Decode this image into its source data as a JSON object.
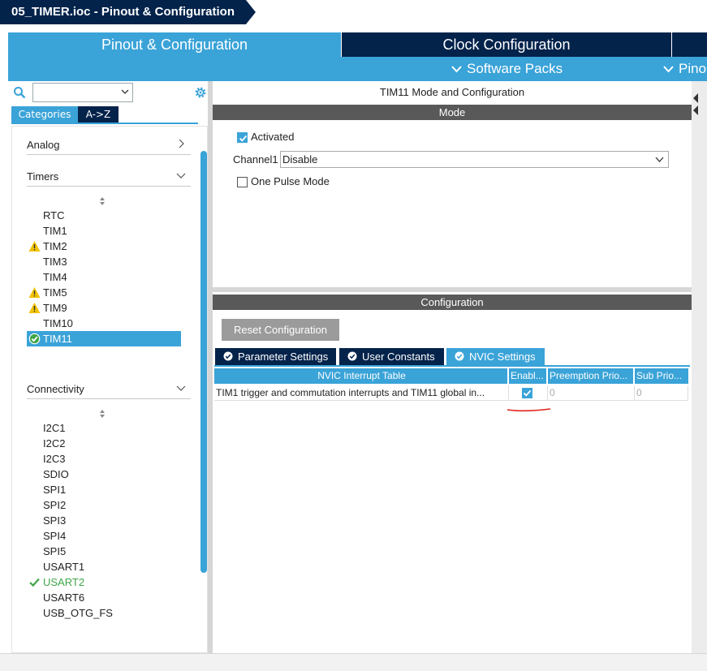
{
  "window": {
    "title": "05_TIMER.ioc - Pinout & Configuration"
  },
  "main_tabs": [
    {
      "label": "Pinout & Configuration"
    },
    {
      "label": "Clock Configuration"
    }
  ],
  "subbar": {
    "software_packs": "Software Packs",
    "pinout": "Pino"
  },
  "left": {
    "category_tabs": {
      "categories": "Categories",
      "atoz": "A->Z"
    },
    "groups": {
      "analog": "Analog",
      "timers": "Timers",
      "connectivity": "Connectivity"
    },
    "timers": [
      "RTC",
      "TIM1",
      "TIM2",
      "TIM3",
      "TIM4",
      "TIM5",
      "TIM9",
      "TIM10",
      "TIM11"
    ],
    "connectivity": [
      "I2C1",
      "I2C2",
      "I2C3",
      "SDIO",
      "SPI1",
      "SPI2",
      "SPI3",
      "SPI4",
      "SPI5",
      "USART1",
      "USART2",
      "USART6",
      "USB_OTG_FS"
    ]
  },
  "right": {
    "title": "TIM11 Mode and Configuration",
    "mode_header": "Mode",
    "activated_label": "Activated",
    "channel1_label": "Channel1",
    "channel1_value": "Disable",
    "one_pulse_label": "One Pulse Mode",
    "config_header": "Configuration",
    "reset_button": "Reset Configuration",
    "config_tabs": {
      "parameter": "Parameter Settings",
      "user_constants": "User Constants",
      "nvic": "NVIC Settings"
    },
    "table": {
      "headers": {
        "name": "NVIC Interrupt Table",
        "enabled": "Enabl...",
        "preemption": "Preemption Prio...",
        "sub": "Sub Prio..."
      },
      "row": {
        "name": "TIM1 trigger and commutation interrupts and TIM11 global in...",
        "preemption": "0",
        "sub": "0"
      }
    }
  },
  "colors": {
    "accent": "#3aa3d8",
    "navy": "#03234b",
    "section": "#595959",
    "warning": "#f2c200",
    "ok": "#3fa54a",
    "mark": "#e2231a"
  }
}
